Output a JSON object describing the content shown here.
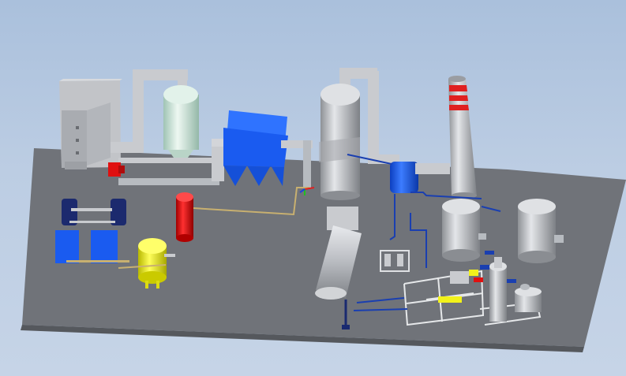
{
  "viewport": {
    "background_top": "#aac0dc",
    "background_bottom": "#c6d4e7"
  },
  "colors": {
    "floor": "#707379",
    "equipment_grey": "#c9cbcf",
    "duct_grey": "#b7bbc0",
    "blue_equipment": "#1a5bf0",
    "navy_pump": "#1c2a6e",
    "red_vessel": "#e01010",
    "yellow_vessel": "#f2f21a",
    "mint_tower": "#cfe8dc",
    "pipe_tan": "#c8b070",
    "pipe_blue": "#1a3fb0",
    "stack_band_red": "#e02020"
  },
  "icons": [
    "axis-triad-icon"
  ]
}
